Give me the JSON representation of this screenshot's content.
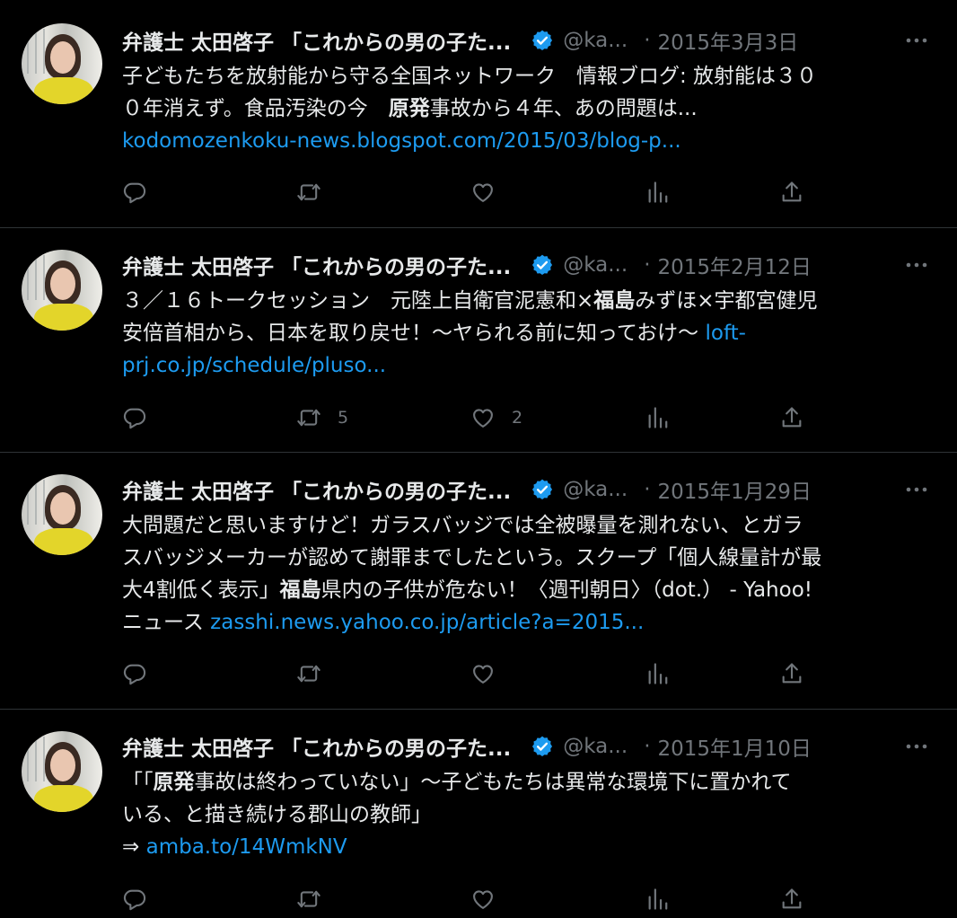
{
  "tweets": [
    {
      "name": "弁護士 太田啓子 「これからの男の子た...",
      "handle": "@ka...",
      "sep": "·",
      "date": "2015年3月3日",
      "lines": [
        [
          {
            "t": "子どもたちを放射能から守る全国ネットワーク　情報ブログ: 放射能は３０"
          }
        ],
        [
          {
            "t": "０年消えず。食品汚染の今　"
          },
          {
            "t": "原発",
            "b": true
          },
          {
            "t": "事故から４年、あの問題は..."
          }
        ],
        [
          {
            "t": "kodomozenkoku-news.blogspot.com/2015/03/blog-p...",
            "link": true
          }
        ]
      ],
      "retweets": "",
      "likes": ""
    },
    {
      "name": "弁護士 太田啓子 「これからの男の子た...",
      "handle": "@ka...",
      "sep": "·",
      "date": "2015年2月12日",
      "lines": [
        [
          {
            "t": "３／１６トークセッション　元陸上自衛官泥憲和×"
          },
          {
            "t": "福島",
            "b": true
          },
          {
            "t": "みずほ×宇都宮健児"
          }
        ],
        [
          {
            "t": "安倍首相から、日本を取り戻せ！〜ヤられる前に知っておけ〜 "
          },
          {
            "t": "loft-",
            "link": true
          }
        ],
        [
          {
            "t": "prj.co.jp/schedule/pluso...",
            "link": true
          }
        ]
      ],
      "retweets": "5",
      "likes": "2"
    },
    {
      "name": "弁護士 太田啓子 「これからの男の子た...",
      "handle": "@ka...",
      "sep": "·",
      "date": "2015年1月29日",
      "lines": [
        [
          {
            "t": "大問題だと思いますけど！ガラスバッジでは全被曝量を測れない、とガラ"
          }
        ],
        [
          {
            "t": "スバッジメーカーが認めて謝罪までしたという。スクープ「個人線量計が最"
          }
        ],
        [
          {
            "t": "大4割低く表示」"
          },
          {
            "t": "福島",
            "b": true
          },
          {
            "t": "県内の子供が危ない！〈週刊朝日〉（dot.） - Yahoo!"
          }
        ],
        [
          {
            "t": "ニュース "
          },
          {
            "t": "zasshi.news.yahoo.co.jp/article?a=2015...",
            "link": true
          }
        ]
      ],
      "retweets": "",
      "likes": ""
    },
    {
      "name": "弁護士 太田啓子 「これからの男の子た...",
      "handle": "@ka...",
      "sep": "·",
      "date": "2015年1月10日",
      "lines": [
        [
          {
            "t": "「「"
          },
          {
            "t": "原発",
            "b": true
          },
          {
            "t": "事故は終わっていない」〜子どもたちは異常な環境下に置かれて"
          }
        ],
        [
          {
            "t": "いる、と描き続ける郡山の教師」"
          }
        ],
        [
          {
            "t": "⇒ "
          },
          {
            "t": "amba.to/14WmkNV",
            "link": true
          }
        ]
      ],
      "retweets": "",
      "likes": ""
    }
  ],
  "colors": {
    "background": "#000000",
    "text": "#e7e9ea",
    "muted": "#71767b",
    "link": "#1d9bf0",
    "verified": "#1d9bf0",
    "divider": "#2f3336"
  },
  "icons": {
    "reply": "speech-bubble-icon",
    "retweet": "retweet-arrows-icon",
    "like": "heart-outline-icon",
    "views": "bar-chart-icon",
    "share": "share-upload-icon",
    "more": "three-dots-icon",
    "verified": "verified-badge-icon"
  }
}
